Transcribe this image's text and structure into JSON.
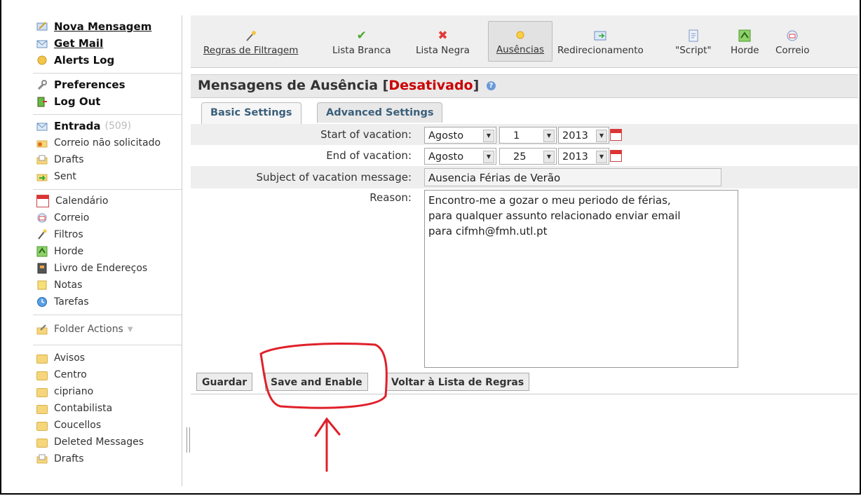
{
  "sidebar": {
    "actions": [
      {
        "label": "Nova Mensagem",
        "icon": "compose-icon"
      },
      {
        "label": "Get Mail",
        "icon": "get-mail-icon"
      },
      {
        "label": "Alerts Log",
        "icon": "alerts-icon"
      }
    ],
    "settings": [
      {
        "label": "Preferences",
        "icon": "wrench-icon"
      },
      {
        "label": "Log Out",
        "icon": "logout-icon"
      }
    ],
    "mailboxes": [
      {
        "label": "Entrada",
        "count": "(509)",
        "icon": "inbox-icon"
      },
      {
        "label": "Correio não solicitado",
        "icon": "spam-icon"
      },
      {
        "label": "Drafts",
        "icon": "drafts-icon"
      },
      {
        "label": "Sent",
        "icon": "sent-icon"
      }
    ],
    "apps": [
      {
        "label": "Calendário",
        "icon": "calendar-icon"
      },
      {
        "label": "Correio",
        "icon": "mail-icon"
      },
      {
        "label": "Filtros",
        "icon": "filter-icon"
      },
      {
        "label": "Horde",
        "icon": "horde-icon"
      },
      {
        "label": "Livro de Endereços",
        "icon": "address-book-icon"
      },
      {
        "label": "Notas",
        "icon": "notes-icon"
      },
      {
        "label": "Tarefas",
        "icon": "tasks-icon"
      }
    ],
    "folder_actions": "Folder Actions",
    "folders": [
      "Avisos",
      "Centro",
      "cipriano",
      "Contabilista",
      "Coucellos",
      "Deleted Messages",
      "Drafts"
    ]
  },
  "toolbar": {
    "items": [
      {
        "label": "Regras de Filtragem",
        "icon": "filter-rules-icon"
      },
      {
        "label": "Lista Branca",
        "icon": "whitelist-check-icon"
      },
      {
        "label": "Lista Negra",
        "icon": "blacklist-x-icon"
      },
      {
        "label": "Ausências",
        "icon": "vacation-sun-icon"
      },
      {
        "label": "Redirecionamento",
        "icon": "forward-icon"
      },
      {
        "label": "\"Script\"",
        "icon": "script-icon"
      },
      {
        "label": "Horde",
        "icon": "horde-icon"
      },
      {
        "label": "Correio",
        "icon": "mail-icon"
      }
    ]
  },
  "page": {
    "title": "Mensagens de Ausência",
    "status": "Desativado",
    "bracket_open": "[",
    "bracket_close": "]"
  },
  "tabs": [
    "Basic Settings",
    "Advanced Settings"
  ],
  "form": {
    "start_label": "Start of vacation:",
    "start_month": "Agosto",
    "start_day": "1",
    "start_year": "2013",
    "end_label": "End of vacation:",
    "end_month": "Agosto",
    "end_day": "25",
    "end_year": "2013",
    "subject_label": "Subject of vacation message:",
    "subject_value": "Ausencia Férias de Verão",
    "reason_label": "Reason:",
    "reason_value": "Encontro-me a gozar o meu periodo de férias,\npara qualquer assunto relacionado enviar email\npara cifmh@fmh.utl.pt"
  },
  "buttons": {
    "save": "Guardar",
    "save_enable": "Save and Enable",
    "back": "Voltar à Lista de Regras"
  },
  "colors": {
    "status_red": "#cc0000",
    "tab_text": "#3a5f7a",
    "annotation": "#e0202a"
  }
}
